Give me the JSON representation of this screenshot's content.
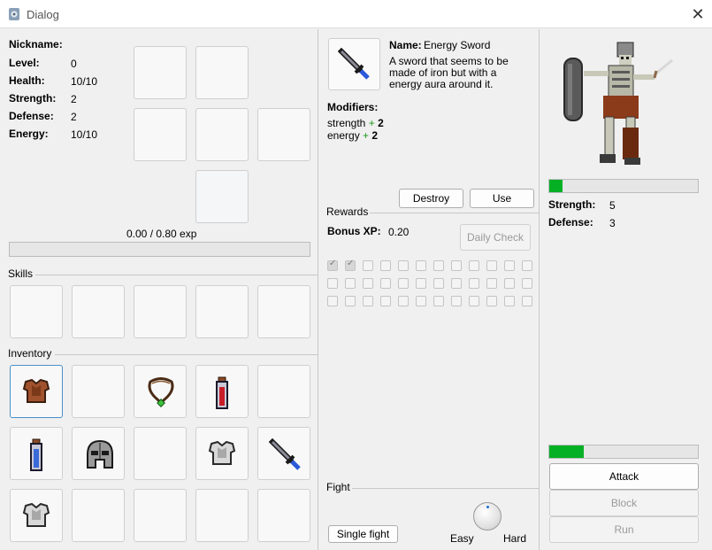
{
  "window": {
    "title": "Dialog"
  },
  "stats": {
    "rows": [
      {
        "label": "Nickname:",
        "value": ""
      },
      {
        "label": "Level:",
        "value": "0"
      },
      {
        "label": "Health:",
        "value": "10/10"
      },
      {
        "label": "Strength:",
        "value": "2"
      },
      {
        "label": "Defense:",
        "value": "2"
      },
      {
        "label": "Energy:",
        "value": "10/10"
      }
    ],
    "exp_text": "0.00 / 0.80 exp",
    "exp_fraction": 0.0
  },
  "skills": {
    "label": "Skills"
  },
  "inventory": {
    "label": "Inventory",
    "items": [
      "leather-armor",
      "",
      "amulet",
      "red-potion",
      "",
      "blue-potion",
      "iron-helmet",
      "",
      "silver-armor",
      "energy-sword",
      "silver-armor",
      "",
      "",
      "",
      ""
    ]
  },
  "item": {
    "name_label": "Name:",
    "name": "Energy Sword",
    "description": "A sword that seems to be made of iron but with a energy aura around it.",
    "modifiers_label": "Modifiers:",
    "modifiers": [
      {
        "stat": "strength",
        "sign": "+",
        "amount": "2"
      },
      {
        "stat": "energy",
        "sign": "+",
        "amount": "2"
      }
    ],
    "destroy_label": "Destroy",
    "use_label": "Use"
  },
  "rewards": {
    "label": "Rewards",
    "bonus_label": "Bonus XP:",
    "bonus_value": "0.20",
    "daily_check_label": "Daily Check",
    "checked_count": 2
  },
  "fight": {
    "label": "Fight",
    "single_fight_label": "Single fight",
    "easy_label": "Easy",
    "hard_label": "Hard",
    "difficulty": 0.5
  },
  "enemy": {
    "health_fraction": 0.09,
    "strength_label": "Strength:",
    "strength_value": "5",
    "defense_label": "Defense:",
    "defense_value": "3",
    "energy_fraction": 0.23,
    "attack_label": "Attack",
    "block_label": "Block",
    "run_label": "Run"
  }
}
